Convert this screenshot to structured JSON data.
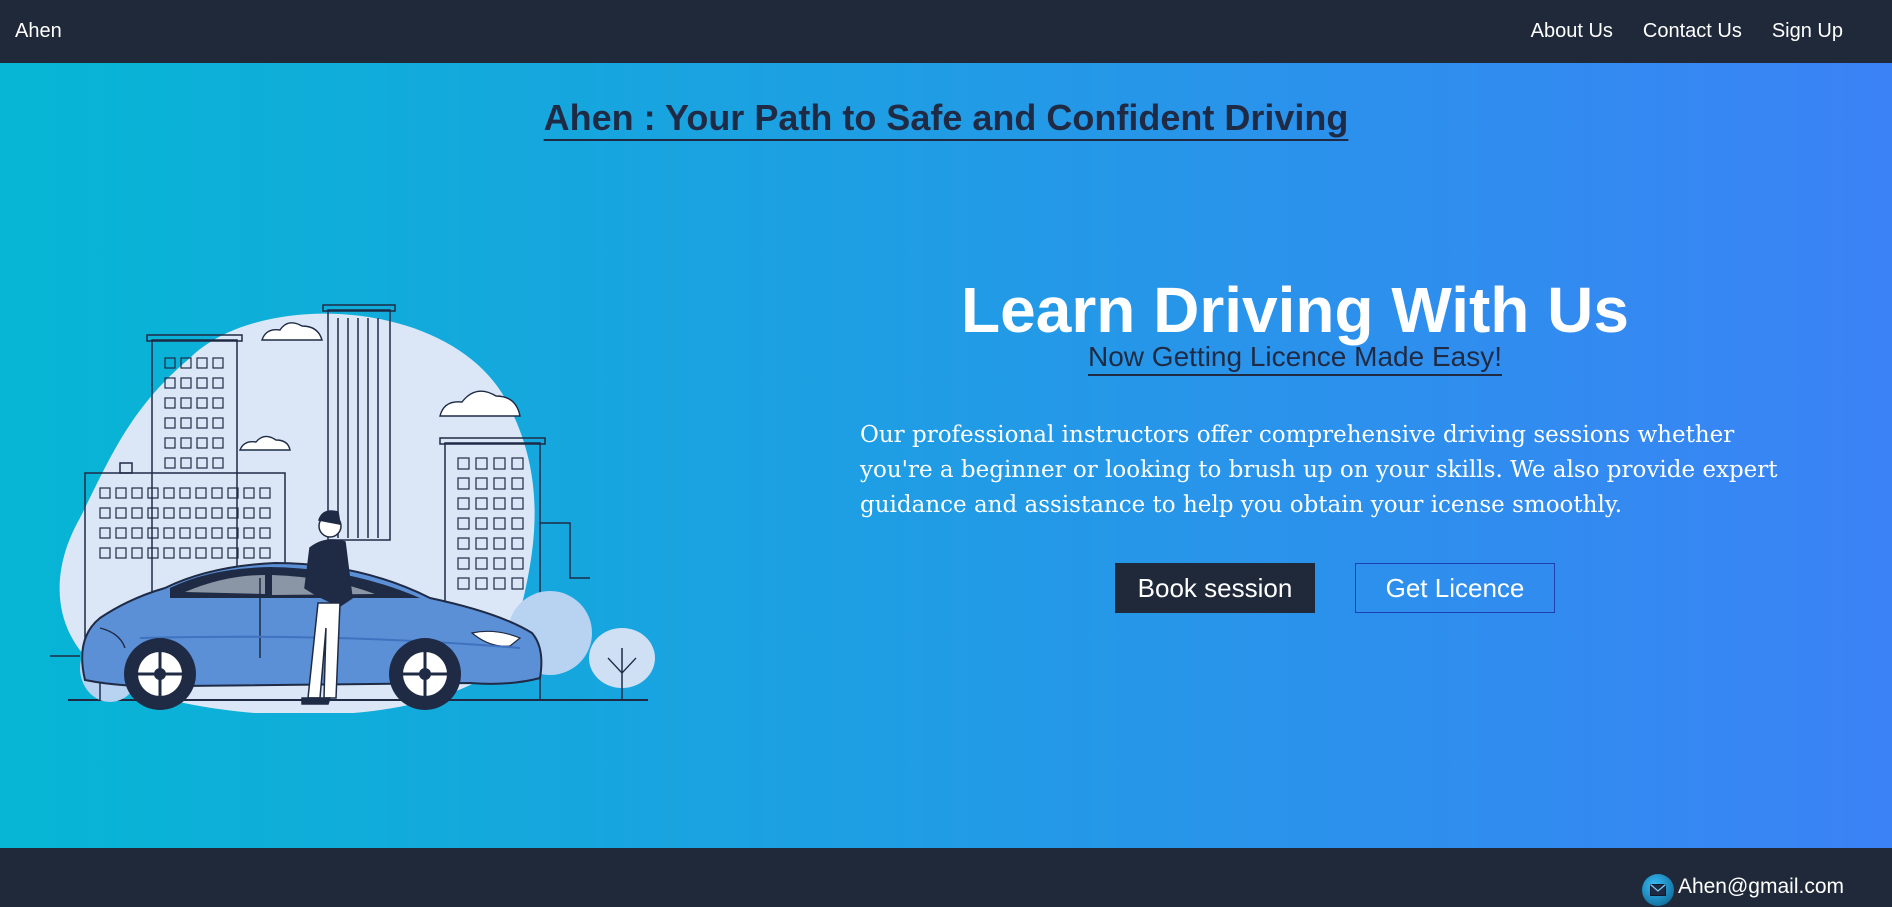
{
  "navbar": {
    "brand": "Ahen",
    "links": [
      "About Us",
      "Contact Us",
      "Sign Up"
    ]
  },
  "hero": {
    "title": "Ahen : Your Path to Safe and Confident Driving",
    "headline": "Learn Driving With Us",
    "subheadline": "Now Getting Licence Made Easy!",
    "description": "Our professional instructors offer comprehensive driving sessions whether you're a beginner or looking to brush up on your skills. We also provide expert guidance and assistance to help you obtain your icense smoothly.",
    "buttons": {
      "book": "Book session",
      "licence": "Get Licence"
    },
    "illustration": "man-leaning-on-car-city-illustration"
  },
  "footer": {
    "email": "Ahen@gmail.com",
    "email_icon": "mail-icon"
  },
  "colors": {
    "navbar_bg": "#1f293a",
    "gradient_start": "#06b6d4",
    "gradient_end": "#3b82f6",
    "heading_dark": "#1f2b45",
    "button_dark": "#1f293a",
    "button_outline": "#1e40af"
  }
}
